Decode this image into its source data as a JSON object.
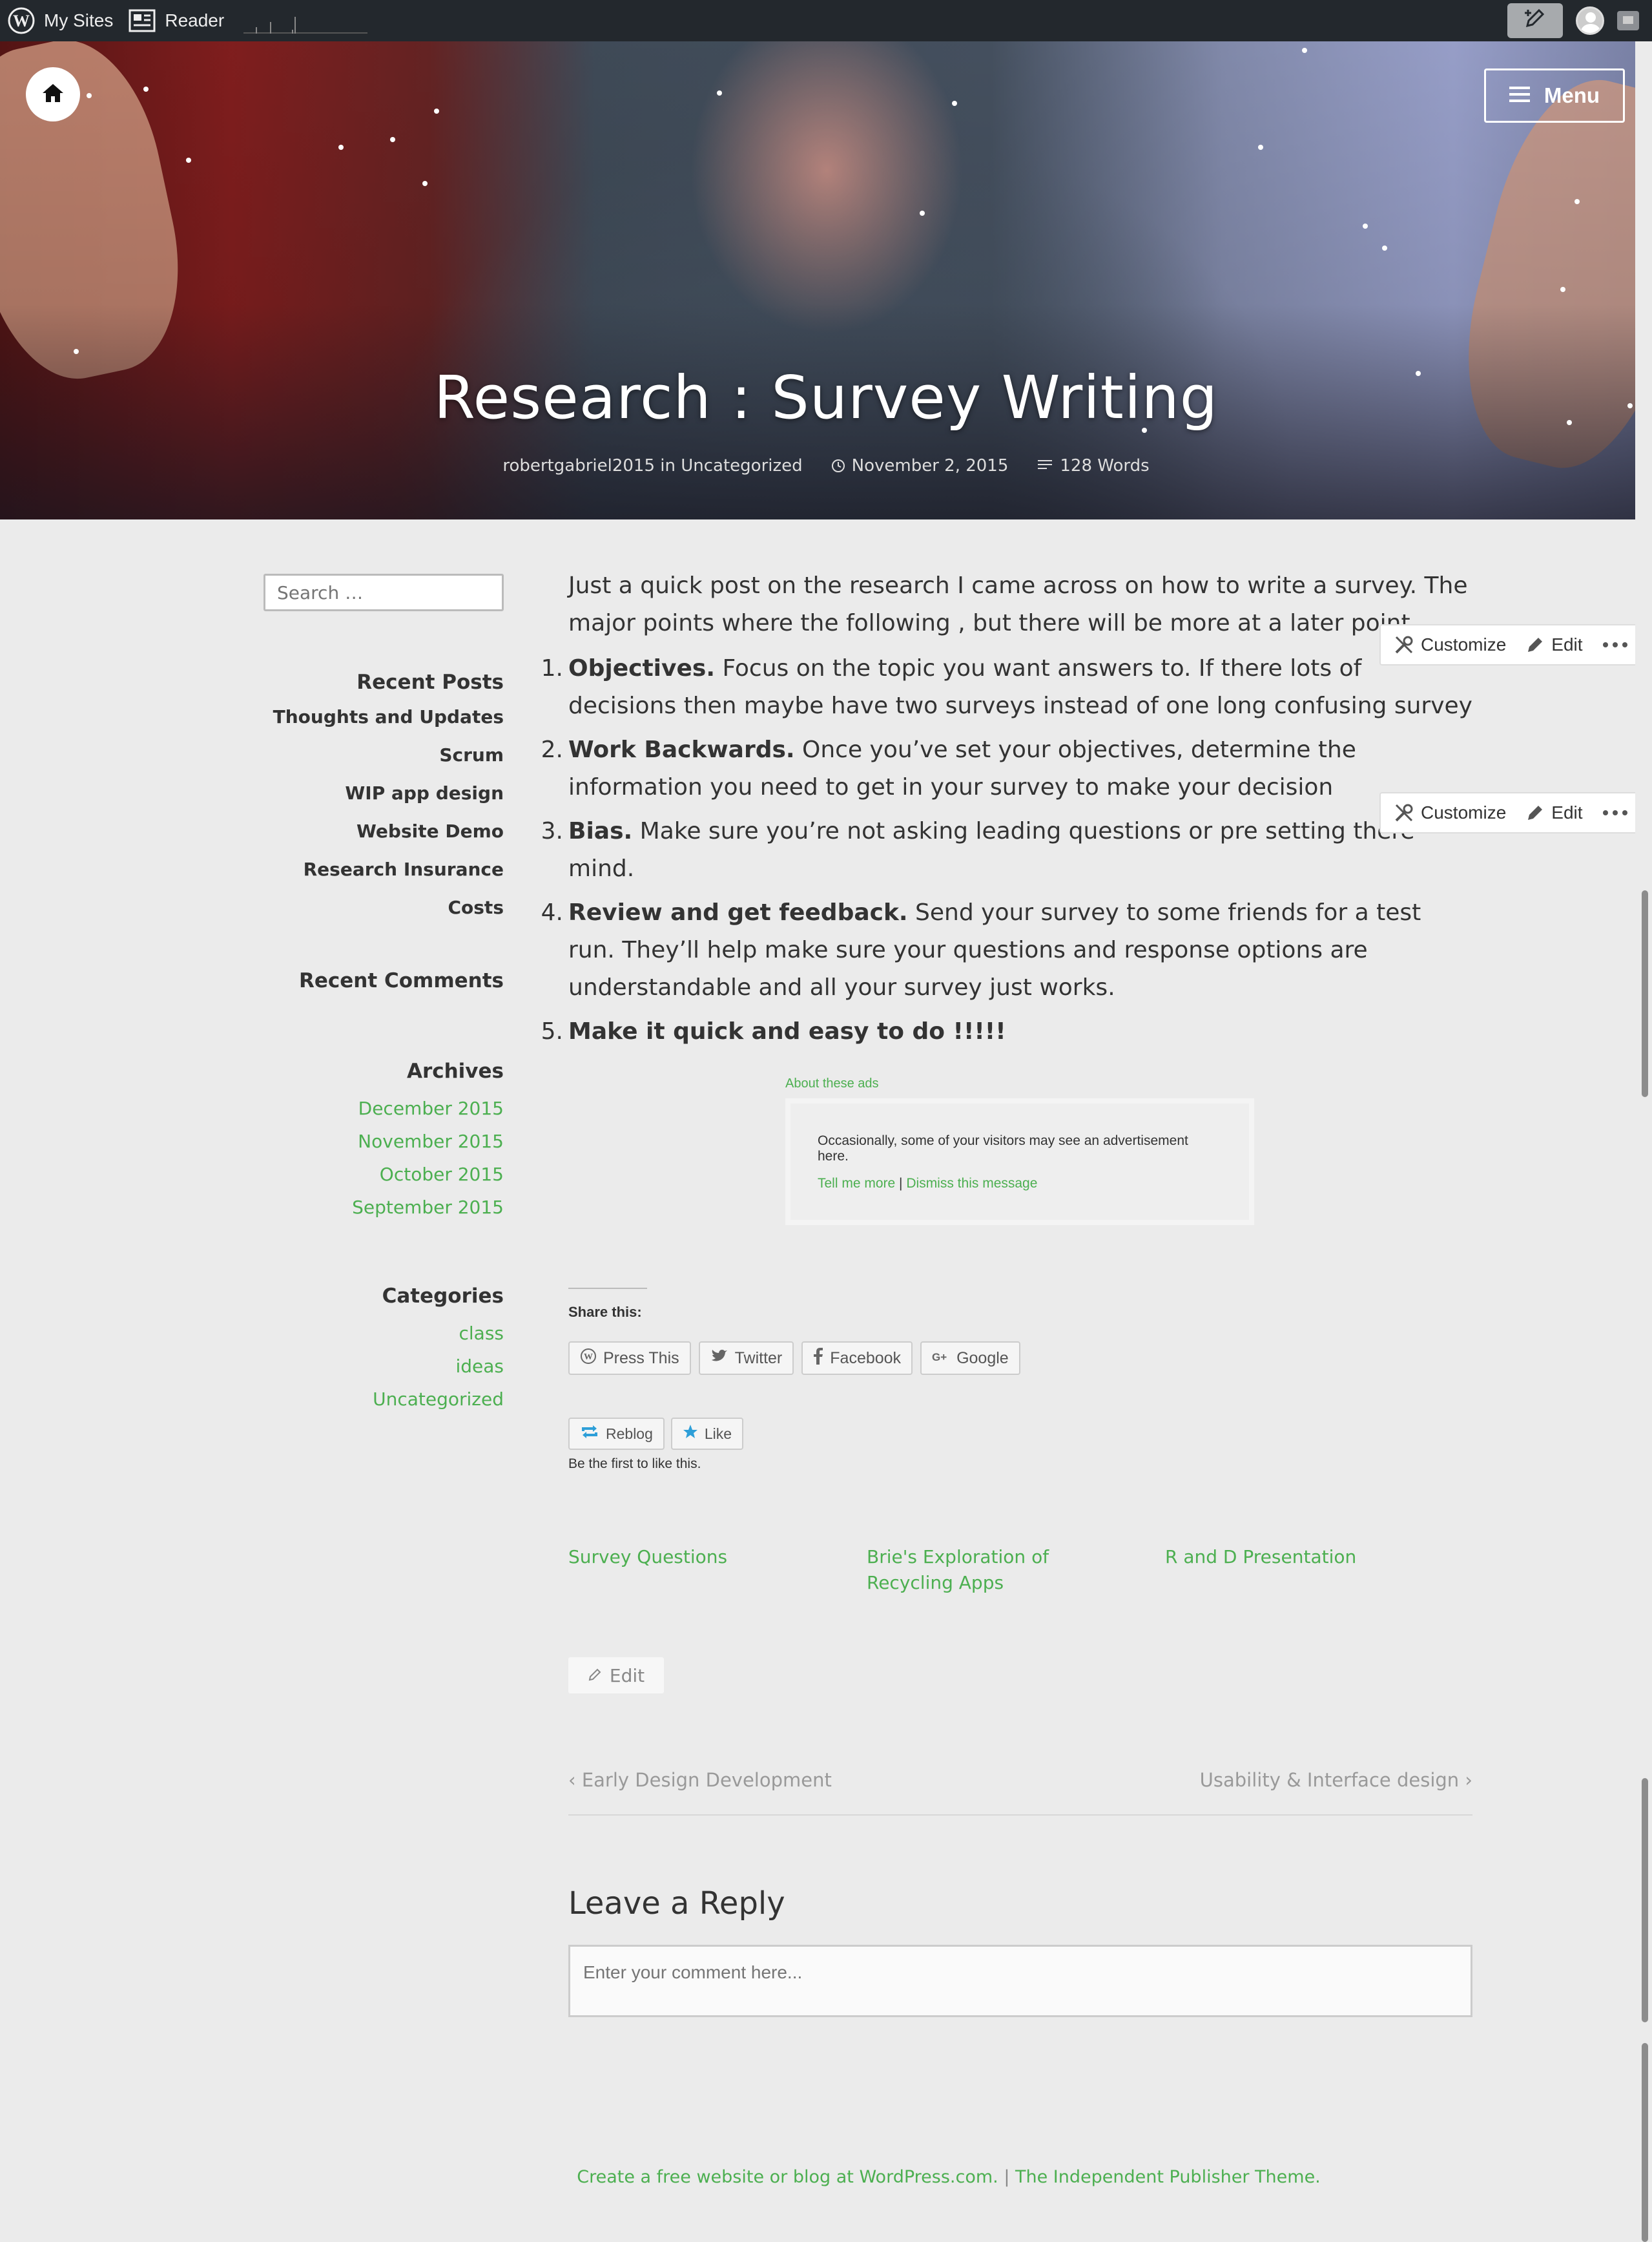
{
  "adminbar": {
    "my_sites": "My Sites",
    "reader": "Reader"
  },
  "hero": {
    "menu_label": "Menu",
    "title": "Research : Survey Writing",
    "author_line": "robertgabriel2015 in Uncategorized",
    "date": "November 2, 2015",
    "words": "128 Words"
  },
  "sidebar": {
    "search_placeholder": "Search …",
    "recent_posts_title": "Recent Posts",
    "recent_posts": [
      "Thoughts and Updates",
      "Scrum",
      "WIP app design",
      "Website Demo",
      "Research Insurance Costs"
    ],
    "recent_comments_title": "Recent Comments",
    "archives_title": "Archives",
    "archives": [
      "December 2015",
      "November 2015",
      "October 2015",
      "September 2015"
    ],
    "categories_title": "Categories",
    "categories": [
      "class",
      "ideas",
      "Uncategorized"
    ]
  },
  "post": {
    "intro": "Just a quick post on the research I came across on how to write a survey. The major points where the following , but there will be more at a later point.",
    "points": [
      {
        "num": "1.",
        "bold": "Objectives.",
        "text": " Focus on the topic you want answers to. If there lots of decisions then maybe have two surveys instead of one long confusing survey"
      },
      {
        "num": "2.",
        "bold": "Work Backwards.",
        "text": " Once you’ve set your objectives, determine the information you need to get in your survey to make your decision"
      },
      {
        "num": "3.",
        "bold": "Bias.",
        "text": " Make sure you’re not asking leading questions or pre setting there mind."
      },
      {
        "num": "4.",
        "bold": "Review and get feedback.",
        "text": " Send your survey to some friends for a test run. They’ll help make sure your questions and response options are understandable and all your survey just works."
      },
      {
        "num": "5.",
        "bold": "Make it quick and easy to do !!!!!",
        "text": ""
      }
    ],
    "customize_label": "Customize",
    "edit_label": "Edit"
  },
  "ads": {
    "about": "About these ads",
    "message": "Occasionally, some of your visitors may see an advertisement here.",
    "tell_more": "Tell me more",
    "separator": "|",
    "dismiss": "Dismiss this message"
  },
  "share": {
    "title": "Share this:",
    "buttons": [
      "Press This",
      "Twitter",
      "Facebook",
      "Google"
    ],
    "reblog": "Reblog",
    "like": "Like",
    "like_note": "Be the first to like this."
  },
  "related": [
    "Survey Questions",
    "Brie's Exploration of Recycling Apps",
    "R and D Presentation"
  ],
  "edit_label": "Edit",
  "post_nav": {
    "prev": "Early Design Development",
    "next": "Usability & Interface design"
  },
  "reply": {
    "title": "Leave a Reply",
    "placeholder": "Enter your comment here..."
  },
  "footer": {
    "link1": "Create a free website or blog at WordPress.com.",
    "sep": " | ",
    "link2": "The Independent Publisher Theme."
  },
  "colors": {
    "accent": "#4caf50",
    "adminbar": "#23282d",
    "background": "#ebebeb"
  }
}
